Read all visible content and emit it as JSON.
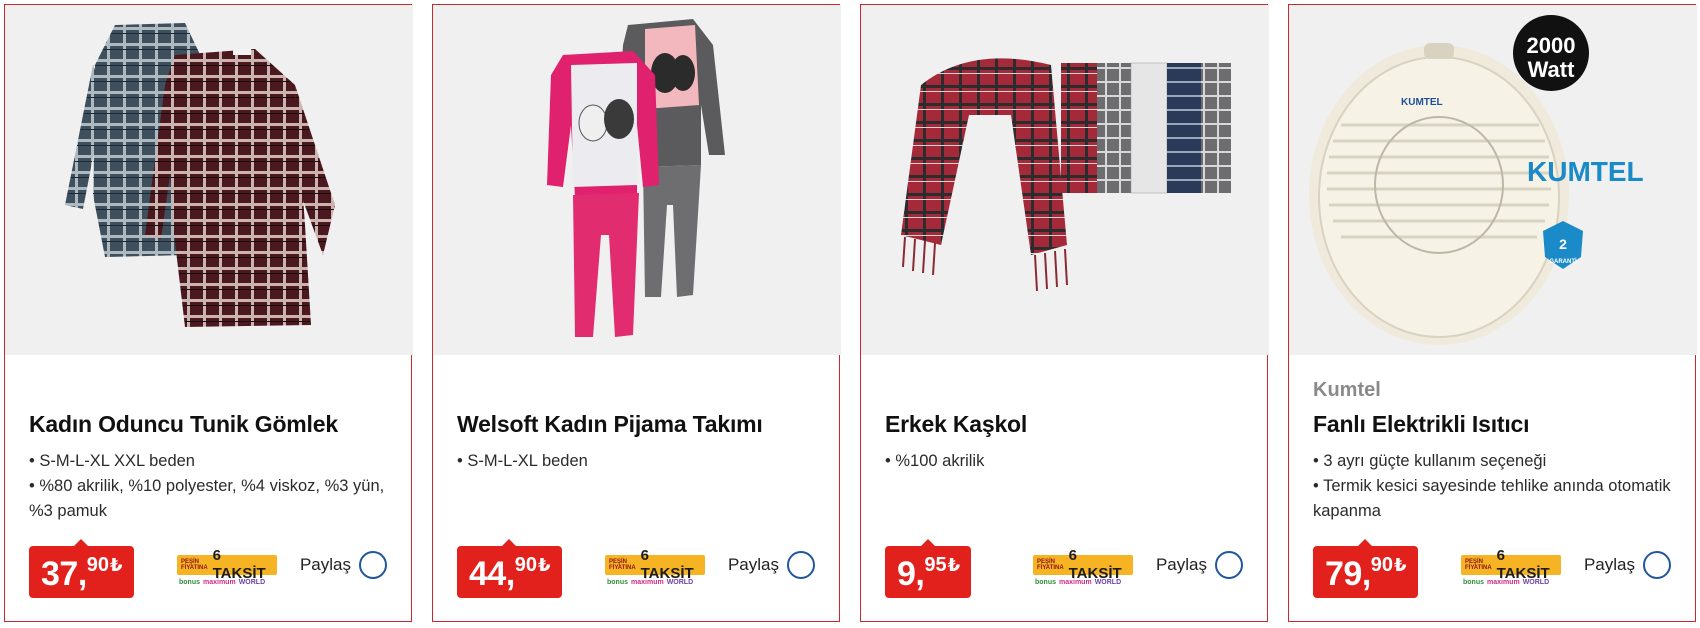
{
  "products": [
    {
      "brand": "",
      "title": "Kadın Oduncu Tunik Gömlek",
      "features": [
        "S-M-L-XL XXL beden",
        "%80 akrilik, %10 polyester, %4 viskoz, %3 yün, %3 pamuk"
      ],
      "price": {
        "int": "37,",
        "dec": "90",
        "currency": "₺"
      },
      "installment": {
        "small": "PEŞİN FİYATINA",
        "big": "6 TAKSİT",
        "cards": [
          "bonus",
          "maximum",
          "WORLD"
        ]
      },
      "share_label": "Paylaş",
      "image": "plaid-tunic-shirts"
    },
    {
      "brand": "",
      "title": "Welsoft Kadın Pijama Takımı",
      "features": [
        "S-M-L-XL beden"
      ],
      "price": {
        "int": "44,",
        "dec": "90",
        "currency": "₺"
      },
      "installment": {
        "small": "PEŞİN FİYATINA",
        "big": "6 TAKSİT",
        "cards": [
          "bonus",
          "maximum",
          "WORLD"
        ]
      },
      "share_label": "Paylaş",
      "image": "pajama-sets"
    },
    {
      "brand": "",
      "title": "Erkek Kaşkol",
      "features": [
        "%100 akrilik"
      ],
      "price": {
        "int": "9,",
        "dec": "95",
        "currency": "₺"
      },
      "installment": {
        "small": "PEŞİN FİYATINA",
        "big": "6 TAKSİT",
        "cards": [
          "bonus",
          "maximum",
          "WORLD"
        ]
      },
      "share_label": "Paylaş",
      "image": "plaid-scarves"
    },
    {
      "brand": "Kumtel",
      "title": "Fanlı Elektrikli Isıtıcı",
      "features": [
        "3 ayrı güçte kullanım seçeneği",
        "Termik kesici sayesinde tehlike anında otomatik kapanma"
      ],
      "price": {
        "int": "79,",
        "dec": "90",
        "currency": "₺"
      },
      "installment": {
        "small": "PEŞİN FİYATINA",
        "big": "6 TAKSİT",
        "cards": [
          "bonus",
          "maximum",
          "WORLD"
        ]
      },
      "share_label": "Paylaş",
      "image": "fan-heater",
      "image_texts": {
        "badge_line1": "2000",
        "badge_line2": "Watt",
        "brand_logo": "KUMTEL",
        "heater_label": "KUMTEL",
        "warranty_num": "2",
        "warranty_text": "GARANTİ"
      }
    }
  ],
  "colors": {
    "accent": "#e2211c",
    "border": "#c8282e",
    "share": "#20579c",
    "installment": "#f6b323"
  }
}
